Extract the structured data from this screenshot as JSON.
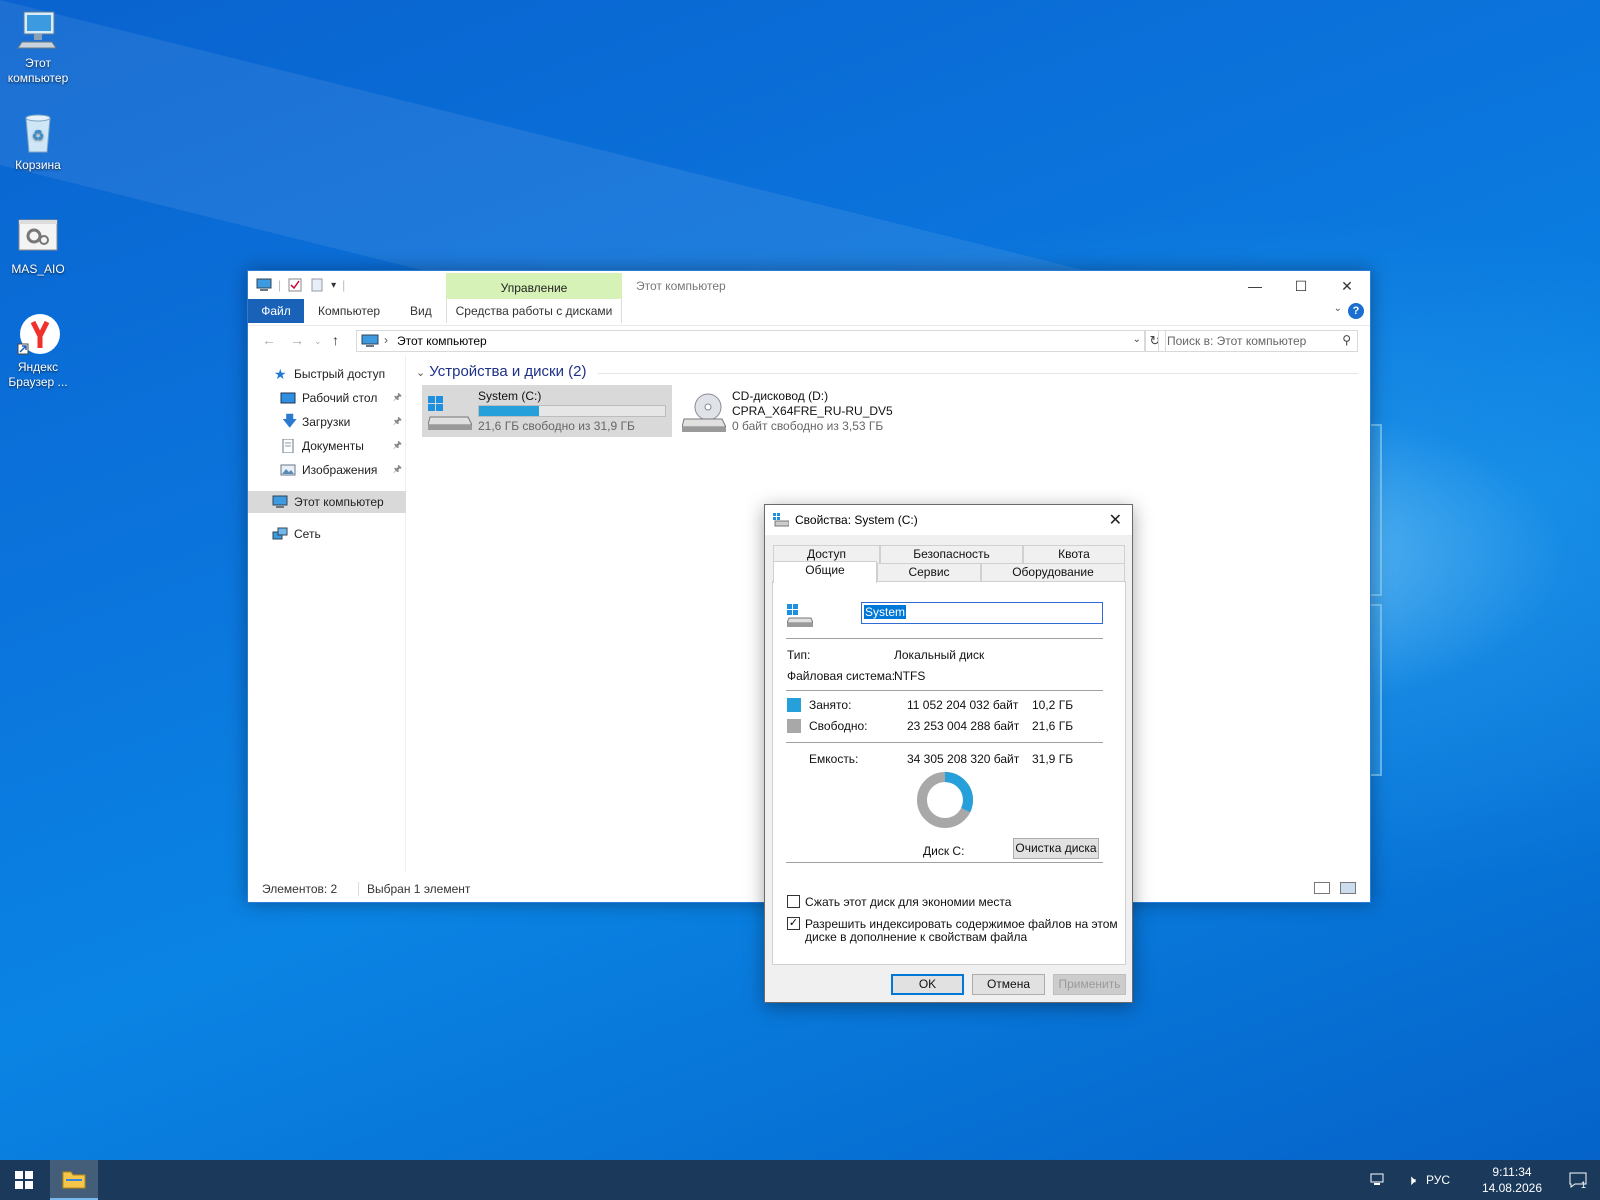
{
  "desktop": {
    "icons": [
      {
        "label": "Этот компьютер"
      },
      {
        "label": "Корзина"
      },
      {
        "label": "MAS_AIO"
      },
      {
        "label": "Яндекс Браузер ..."
      }
    ]
  },
  "explorer": {
    "title": "Этот компьютер",
    "contextual_tab_group": "Управление",
    "ribbon_tabs": [
      "Файл",
      "Компьютер",
      "Вид",
      "Средства работы с дисками"
    ],
    "address_path": "Этот компьютер",
    "search_placeholder": "Поиск в: Этот компьютер",
    "nav": {
      "quick_access": "Быстрый доступ",
      "desktop": "Рабочий стол",
      "downloads": "Загрузки",
      "documents": "Документы",
      "pictures": "Изображения",
      "this_pc": "Этот компьютер",
      "network": "Сеть"
    },
    "group_header": "Устройства и диски (2)",
    "drives": [
      {
        "name": "System (C:)",
        "free_text": "21,6 ГБ свободно из 31,9 ГБ",
        "used_fraction": 0.32
      },
      {
        "name": "CD-дисковод (D:)",
        "label": "CPRA_X64FRE_RU-RU_DV5",
        "free_text": "0 байт свободно из 3,53 ГБ"
      }
    ],
    "status": {
      "items": "Элементов: 2",
      "selected": "Выбран 1 элемент"
    }
  },
  "properties": {
    "title": "Свойства: System (C:)",
    "tabs_back": [
      "Доступ",
      "Безопасность",
      "Квота"
    ],
    "tabs_front": [
      "Общие",
      "Сервис",
      "Оборудование"
    ],
    "volume_name": "System",
    "type_label": "Тип:",
    "type_value": "Локальный диск",
    "fs_label": "Файловая система:",
    "fs_value": "NTFS",
    "used_label": "Занято:",
    "used_bytes": "11 052 204 032 байт",
    "used_gb": "10,2 ГБ",
    "free_label": "Свободно:",
    "free_bytes": "23 253 004 288 байт",
    "free_gb": "21,6 ГБ",
    "capacity_label": "Емкость:",
    "capacity_bytes": "34 305 208 320 байт",
    "capacity_gb": "31,9 ГБ",
    "used_fraction": 0.322,
    "disk_label": "Диск C:",
    "cleanup_button": "Очистка диска",
    "compress_label": "Сжать этот диск для экономии места",
    "compress_checked": false,
    "index_label_line1": "Разрешить индексировать содержимое файлов на этом",
    "index_label_line2": "диске в дополнение к свойствам файла",
    "index_checked": true,
    "ok": "OK",
    "cancel": "Отмена",
    "apply": "Применить",
    "used_color": "#26a0da",
    "free_color": "#a8a8a8"
  },
  "taskbar": {
    "language": "РУС",
    "time": "9:11:34",
    "date": "14.08.2026",
    "notification_count": "1"
  }
}
